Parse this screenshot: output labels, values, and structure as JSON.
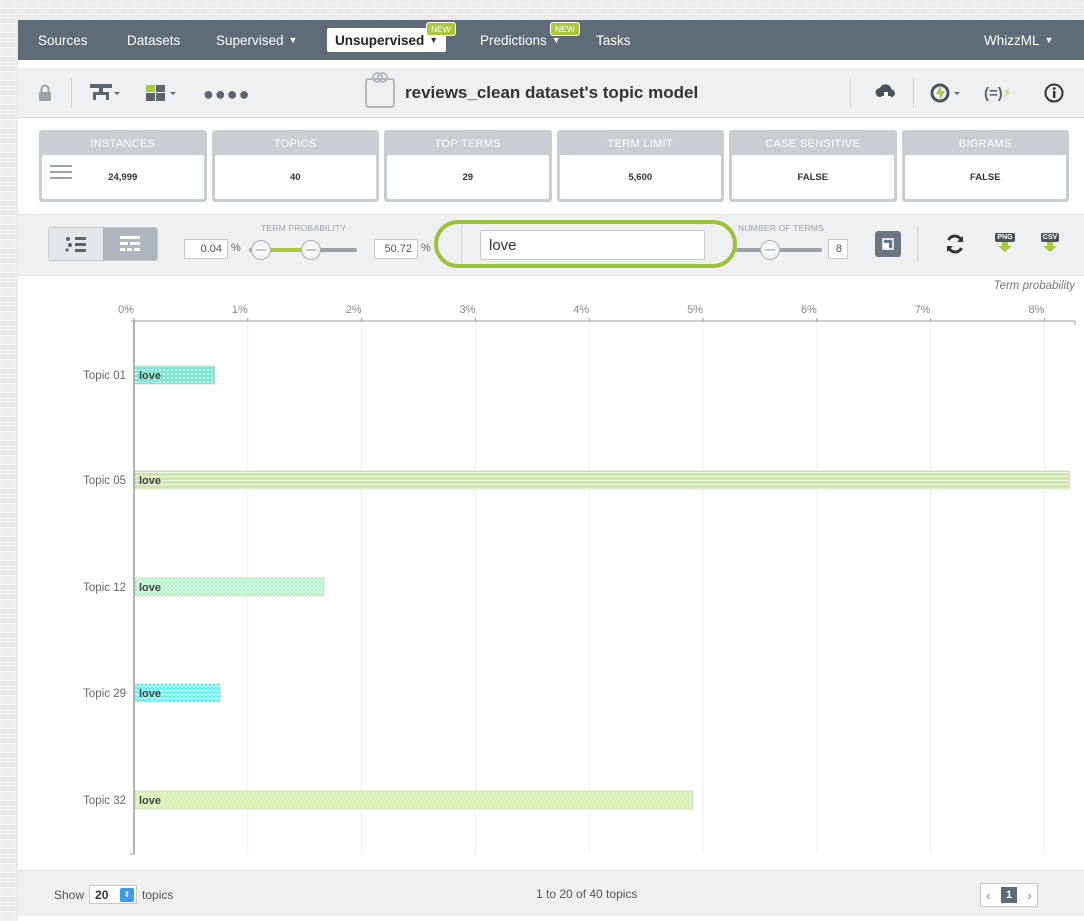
{
  "nav": {
    "items": [
      {
        "label": "Sources"
      },
      {
        "label": "Datasets"
      },
      {
        "label": "Supervised"
      },
      {
        "label": "Unsupervised",
        "badge": "NEW"
      },
      {
        "label": "Predictions",
        "badge": "NEW"
      },
      {
        "label": "Tasks"
      }
    ],
    "right": "WhizzML"
  },
  "resource": {
    "title": "reviews_clean dataset's topic model"
  },
  "summary": [
    {
      "label": "INSTANCES",
      "value": "24,999"
    },
    {
      "label": "TOPICS",
      "value": "40"
    },
    {
      "label": "TOP TERMS",
      "value": "29"
    },
    {
      "label": "TERM LIMIT",
      "value": "5,600"
    },
    {
      "label": "CASE SENSITIVE",
      "value": "FALSE"
    },
    {
      "label": "BIGRAMS",
      "value": "FALSE"
    }
  ],
  "controls": {
    "term_probability_label": "TERM PROBABILITY",
    "min_value": "0.04",
    "max_value": "50.72",
    "pct": "%",
    "search_value": "love",
    "number_of_terms_label": "NUMBER OF TERMS",
    "number_of_terms": "8",
    "png": "PNG",
    "csv": "CSV"
  },
  "chart_data": {
    "type": "bar",
    "orientation": "horizontal",
    "xlabel": "Term probability",
    "xlim": [
      0,
      8.2
    ],
    "ticks": [
      "0%",
      "1%",
      "2%",
      "3%",
      "4%",
      "5%",
      "6%",
      "7%",
      "8%"
    ],
    "categories": [
      "Topic 01",
      "Topic 05",
      "Topic 12",
      "Topic 29",
      "Topic 32"
    ],
    "values": [
      0.71,
      8.22,
      1.67,
      0.76,
      4.91
    ],
    "bar_label": "love",
    "colors": [
      "#7de8cf",
      "#cfe6a4",
      "#a6efc2",
      "#5ff0f4",
      "#d7eeb4"
    ]
  },
  "footer": {
    "show": "Show",
    "count": "20",
    "unit": "topics",
    "range": "1 to 20 of 40 topics",
    "page": "1"
  }
}
